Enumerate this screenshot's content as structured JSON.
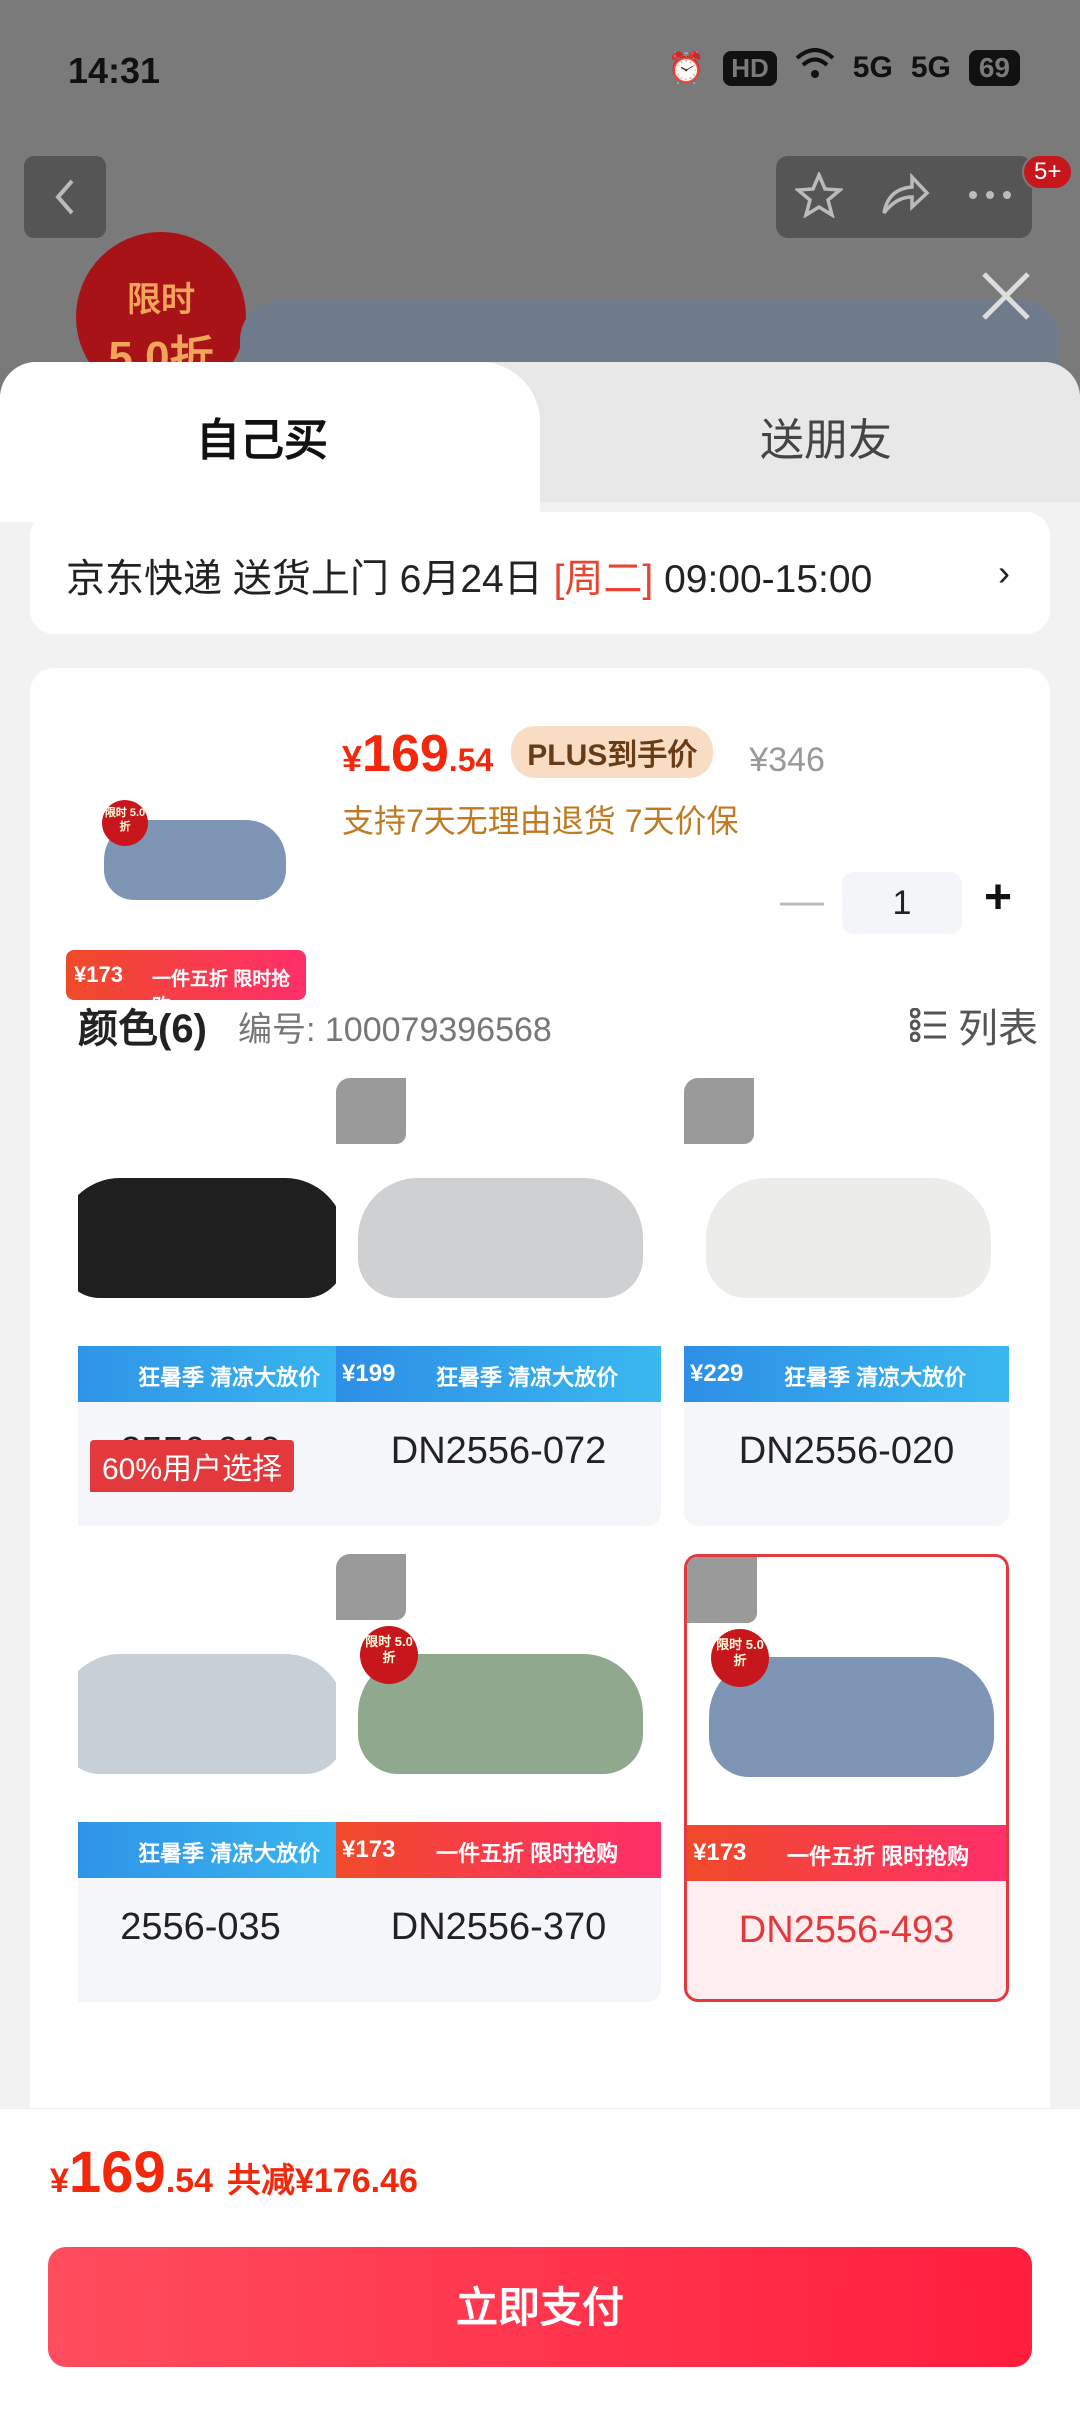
{
  "status_bar": {
    "time": "14:31",
    "network": "5G",
    "battery": "69",
    "hd": "HD"
  },
  "header": {
    "badge": "5+",
    "flash_sale_top": "限时",
    "flash_sale_bottom": "5.0折"
  },
  "tabs": [
    {
      "label": "自己买",
      "active": true
    },
    {
      "label": "送朋友",
      "active": false
    }
  ],
  "delivery": {
    "carrier": "京东快递 送货上门 6月24日 ",
    "weekday": "[周二]",
    "time_window": " 09:00-15:00"
  },
  "product": {
    "price_yen": "¥",
    "price_int": "169",
    "price_dec": ".54",
    "plus_tag": "PLUS到手价",
    "original_price": "¥346",
    "promises": "支持7天无理由退货  7天价保",
    "thumb_badge": "限时 5.0折",
    "thumb_banner_price": "¥173",
    "thumb_banner_text": "一件五折 限时抢购",
    "quantity": "1"
  },
  "color": {
    "title": "颜色(6)",
    "sku_label": "编号: 100079396568",
    "view_toggle": "列表",
    "popular_tag": "60%用户选择"
  },
  "variants": [
    {
      "code": "2556-010",
      "color": "#1f1f1f",
      "banner": "blue",
      "price": "",
      "banner_text": "狂暑季 清凉大放价",
      "has_badge": false
    },
    {
      "code": "DN2556-072",
      "color": "#cfd0d2",
      "banner": "blue",
      "price": "¥199",
      "banner_text": "狂暑季 清凉大放价",
      "has_badge": false
    },
    {
      "code": "DN2556-020",
      "color": "#ececea",
      "banner": "blue",
      "price": "¥229",
      "banner_text": "狂暑季 清凉大放价",
      "has_badge": false
    },
    {
      "code": "2556-035",
      "color": "#c7d0d6",
      "banner": "blue",
      "price": "",
      "banner_text": "狂暑季 清凉大放价",
      "has_badge": false
    },
    {
      "code": "DN2556-370",
      "color": "#8fa88e",
      "banner": "red",
      "price": "¥173",
      "banner_text": "一件五折 限时抢购",
      "has_badge": true
    },
    {
      "code": "DN2556-493",
      "color": "#7f95b5",
      "banner": "red",
      "price": "¥173",
      "banner_text": "一件五折 限时抢购",
      "has_badge": true,
      "selected": true
    }
  ],
  "tile_badge": "限时 5.0折",
  "footer": {
    "yen": "¥",
    "int": "169",
    "dec": ".54",
    "savings": "共减¥176.46",
    "pay_button": "立即支付"
  }
}
